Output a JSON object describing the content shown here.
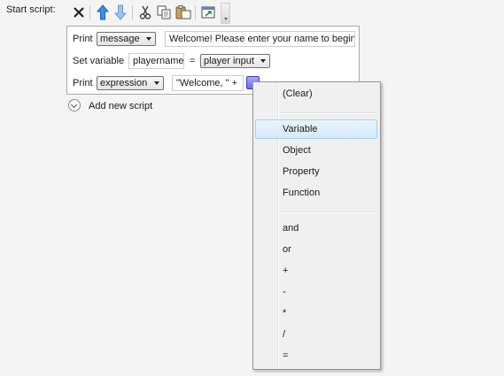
{
  "start_script": {
    "label": "Start script:"
  },
  "toolbar": {
    "buttons": [
      {
        "name": "delete-button",
        "icon": "delete-x-icon"
      },
      {
        "name": "move-up-button",
        "icon": "arrow-up-icon"
      },
      {
        "name": "move-down-button",
        "icon": "arrow-down-icon"
      },
      {
        "name": "cut-button",
        "icon": "scissors-icon"
      },
      {
        "name": "copy-button",
        "icon": "copy-icon"
      },
      {
        "name": "paste-button",
        "icon": "paste-icon"
      },
      {
        "name": "popout-button",
        "icon": "popout-window-icon"
      }
    ],
    "accent_color": "#2b7fd8"
  },
  "scripts": [
    {
      "command": "Print",
      "mode": "message",
      "text": "Welcome! Please enter your name to begin."
    },
    {
      "command": "Set variable",
      "variable": "playername",
      "operator": "=",
      "source": "player input"
    },
    {
      "command": "Print",
      "mode": "expression",
      "expression": "\"Welcome, \" +"
    }
  ],
  "add_script": {
    "label": "Add new script"
  },
  "context_menu": {
    "top_items": [
      "(Clear)"
    ],
    "middle_items": [
      "Variable",
      "Object",
      "Property",
      "Function"
    ],
    "highlighted": "Variable",
    "operators": [
      "and",
      "or",
      "+",
      "-",
      "*",
      "/",
      "="
    ],
    "highlight_color": "#d6eaf8"
  }
}
